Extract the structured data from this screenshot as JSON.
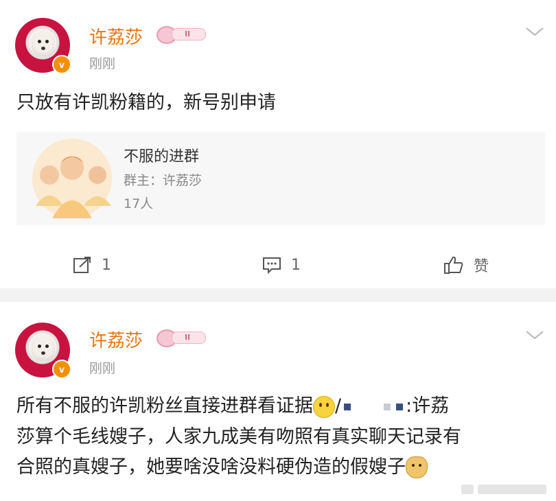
{
  "colors": {
    "accent_orange": "#e8740e",
    "verified_badge": "#f29100",
    "background": "#f2f2f2",
    "card": "#ffffff"
  },
  "posts": [
    {
      "username": "许荔莎",
      "level_badge_text": "II",
      "time": "刚刚",
      "verified_icon": "v",
      "text": "只放有许凯粉籍的，新号别申请",
      "group": {
        "name": "不服的进群",
        "owner": "群主：许荔莎",
        "members": "17人",
        "icon": "people-group-icon"
      },
      "actions": {
        "repost_count": "1",
        "comment_count": "1",
        "like_label": "赞"
      }
    },
    {
      "username": "许荔莎",
      "level_badge_text": "II",
      "time": "刚刚",
      "verified_icon": "v",
      "text_line1_a": "所有不服的许凯粉丝直接进群看证据",
      "text_line1_b": "/",
      "text_line1_c": ":许荔",
      "text_line2": "莎算个毛线嫂子，人家九成美有吻照有真实聊天记录有",
      "text_line3": "合照的真嫂子，她要啥没啥没料硬伪造的假嫂子"
    }
  ]
}
